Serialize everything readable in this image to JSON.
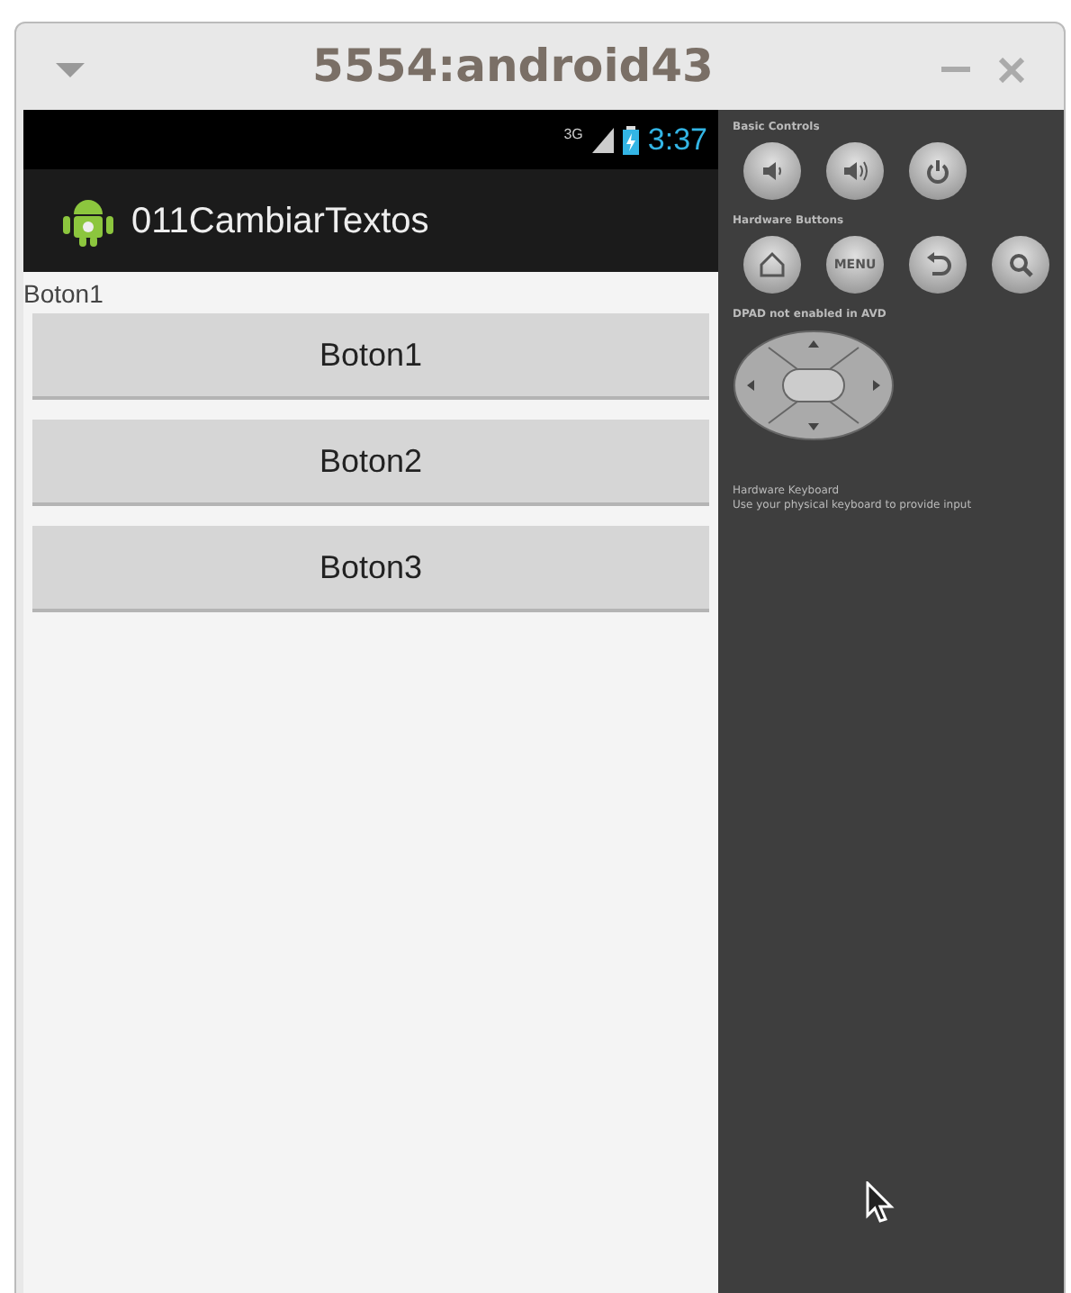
{
  "window": {
    "title": "5554:android43"
  },
  "status_bar": {
    "network": "3G",
    "time": "3:37"
  },
  "action_bar": {
    "title": "011CambiarTextos"
  },
  "content": {
    "label": "Boton1",
    "buttons": [
      "Boton1",
      "Boton2",
      "Boton3"
    ]
  },
  "controls_panel": {
    "sections": [
      {
        "kind": "buttons",
        "title": "Basic Controls",
        "buttons": [
          {
            "kind": "icon"
          },
          {
            "kind": "icon"
          },
          {
            "kind": "icon"
          }
        ]
      },
      {
        "kind": "buttons",
        "title": "Hardware Buttons",
        "buttons": [
          {
            "kind": "icon"
          },
          {
            "kind": "text",
            "label": "MENU"
          },
          {
            "kind": "icon"
          },
          {
            "kind": "icon"
          }
        ]
      },
      {
        "kind": "dpad",
        "title": "DPAD not enabled in AVD"
      },
      {
        "kind": "note",
        "title": "Hardware Keyboard",
        "text": "Use your physical keyboard to provide input"
      }
    ]
  }
}
